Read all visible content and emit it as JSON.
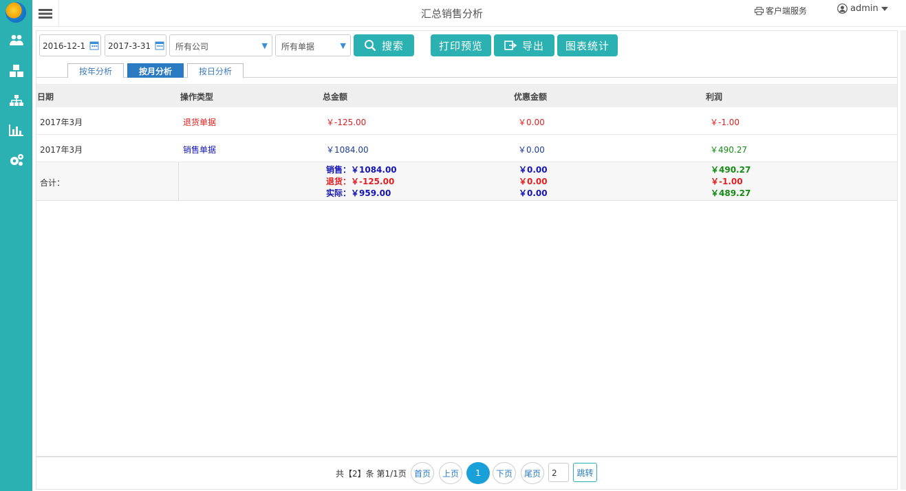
{
  "topbar": {
    "title": "汇总销售分析",
    "service_label": "客户端服务",
    "user_name": "admin"
  },
  "filters": {
    "start_date": "2016-12-1",
    "end_date": "2017-3-31",
    "company": "所有公司",
    "bill_type": "所有单据"
  },
  "buttons": {
    "search": "搜索",
    "print_preview": "打印预览",
    "export": "导出",
    "chart_stats": "图表统计"
  },
  "tabs": [
    "按年分析",
    "按月分析",
    "按日分析"
  ],
  "table": {
    "headers": [
      "日期",
      "操作类型",
      "总金额",
      "优惠金额",
      "利润"
    ],
    "rows": [
      {
        "date": "2017年3月",
        "type": "退货单据",
        "total": "￥-125.00",
        "discount": "￥0.00",
        "profit": "￥-1.00"
      },
      {
        "date": "2017年3月",
        "type": "销售单据",
        "total": "￥1084.00",
        "discount": "￥0.00",
        "profit": "￥490.27"
      }
    ],
    "summary": {
      "label": "合计：",
      "sales_total": "销售：￥1084.00",
      "return_total": "退货：￥-125.00",
      "actual_total": "实际：￥959.00",
      "sales_discount": "￥0.00",
      "return_discount": "￥0.00",
      "actual_discount": "￥0.00",
      "sales_profit": "￥490.27",
      "return_profit": "￥-1.00",
      "actual_profit": "￥489.27"
    }
  },
  "pager": {
    "info": "共【2】条 第1/1页",
    "first": "首页",
    "prev": "上页",
    "current": "1",
    "next": "下页",
    "last": "尾页",
    "goto_value": "2",
    "goto_label": "跳转"
  },
  "colors": {
    "accent": "#2bb1b1",
    "tab_active": "#2a7bc1",
    "negative": "#e02020",
    "positive": "#138a13"
  }
}
